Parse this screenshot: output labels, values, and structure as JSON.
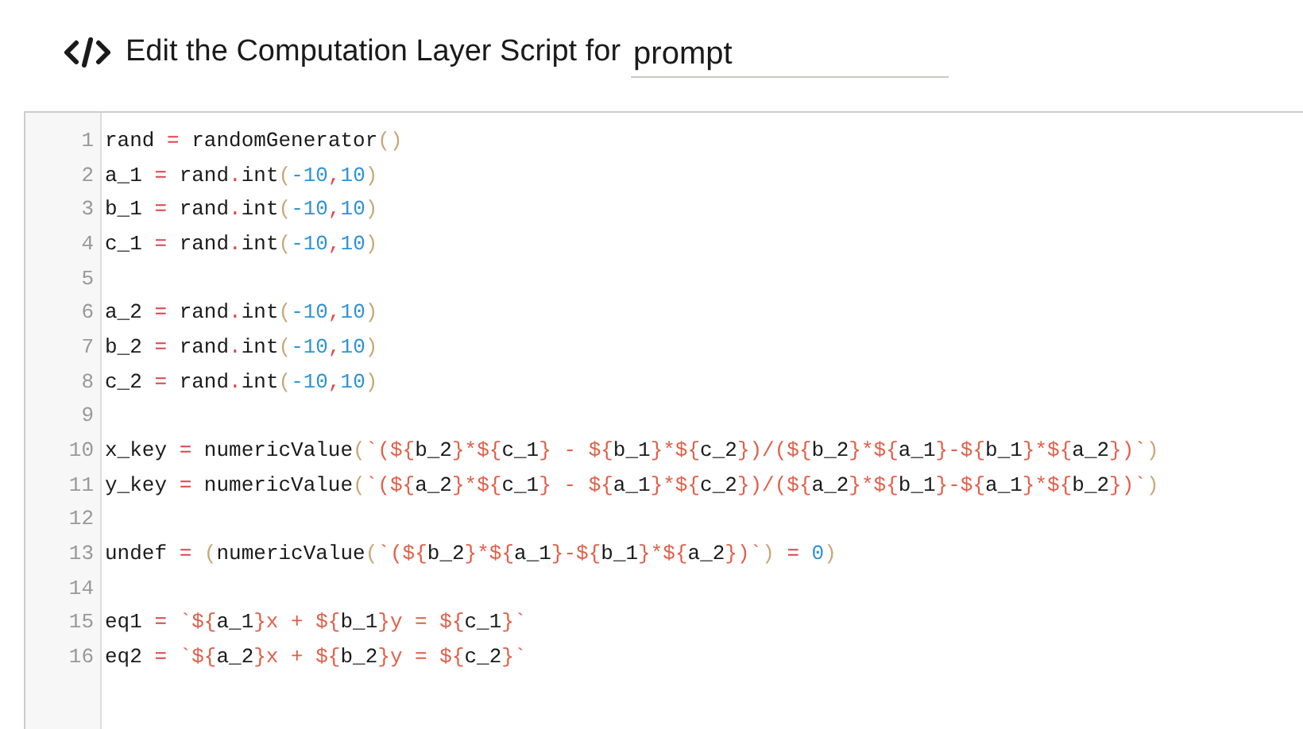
{
  "header": {
    "title": "Edit the Computation Layer Script for",
    "field_value": "prompt"
  },
  "editor": {
    "lines": [
      {
        "number": "1",
        "tokens": [
          {
            "kind": "name",
            "text": "rand"
          },
          {
            "kind": "operator",
            "text": " = "
          },
          {
            "kind": "name",
            "text": "randomGenerator"
          },
          {
            "kind": "bracket",
            "text": "()"
          }
        ]
      },
      {
        "number": "2",
        "tokens": [
          {
            "kind": "name",
            "text": "a_1"
          },
          {
            "kind": "operator",
            "text": " = "
          },
          {
            "kind": "name",
            "text": "rand"
          },
          {
            "kind": "operator",
            "text": "."
          },
          {
            "kind": "name",
            "text": "int"
          },
          {
            "kind": "bracket",
            "text": "("
          },
          {
            "kind": "number",
            "text": "-10"
          },
          {
            "kind": "operator",
            "text": ","
          },
          {
            "kind": "number",
            "text": "10"
          },
          {
            "kind": "bracket",
            "text": ")"
          }
        ]
      },
      {
        "number": "3",
        "tokens": [
          {
            "kind": "name",
            "text": "b_1"
          },
          {
            "kind": "operator",
            "text": " = "
          },
          {
            "kind": "name",
            "text": "rand"
          },
          {
            "kind": "operator",
            "text": "."
          },
          {
            "kind": "name",
            "text": "int"
          },
          {
            "kind": "bracket",
            "text": "("
          },
          {
            "kind": "number",
            "text": "-10"
          },
          {
            "kind": "operator",
            "text": ","
          },
          {
            "kind": "number",
            "text": "10"
          },
          {
            "kind": "bracket",
            "text": ")"
          }
        ]
      },
      {
        "number": "4",
        "tokens": [
          {
            "kind": "name",
            "text": "c_1"
          },
          {
            "kind": "operator",
            "text": " = "
          },
          {
            "kind": "name",
            "text": "rand"
          },
          {
            "kind": "operator",
            "text": "."
          },
          {
            "kind": "name",
            "text": "int"
          },
          {
            "kind": "bracket",
            "text": "("
          },
          {
            "kind": "number",
            "text": "-10"
          },
          {
            "kind": "operator",
            "text": ","
          },
          {
            "kind": "number",
            "text": "10"
          },
          {
            "kind": "bracket",
            "text": ")"
          }
        ]
      },
      {
        "number": "5"
      },
      {
        "number": "6",
        "tokens": [
          {
            "kind": "name",
            "text": "a_2"
          },
          {
            "kind": "operator",
            "text": " = "
          },
          {
            "kind": "name",
            "text": "rand"
          },
          {
            "kind": "operator",
            "text": "."
          },
          {
            "kind": "name",
            "text": "int"
          },
          {
            "kind": "bracket",
            "text": "("
          },
          {
            "kind": "number",
            "text": "-10"
          },
          {
            "kind": "operator",
            "text": ","
          },
          {
            "kind": "number",
            "text": "10"
          },
          {
            "kind": "bracket",
            "text": ")"
          }
        ]
      },
      {
        "number": "7",
        "tokens": [
          {
            "kind": "name",
            "text": "b_2"
          },
          {
            "kind": "operator",
            "text": " = "
          },
          {
            "kind": "name",
            "text": "rand"
          },
          {
            "kind": "operator",
            "text": "."
          },
          {
            "kind": "name",
            "text": "int"
          },
          {
            "kind": "bracket",
            "text": "("
          },
          {
            "kind": "number",
            "text": "-10"
          },
          {
            "kind": "operator",
            "text": ","
          },
          {
            "kind": "number",
            "text": "10"
          },
          {
            "kind": "bracket",
            "text": ")"
          }
        ]
      },
      {
        "number": "8",
        "tokens": [
          {
            "kind": "name",
            "text": "c_2"
          },
          {
            "kind": "operator",
            "text": " = "
          },
          {
            "kind": "name",
            "text": "rand"
          },
          {
            "kind": "operator",
            "text": "."
          },
          {
            "kind": "name",
            "text": "int"
          },
          {
            "kind": "bracket",
            "text": "("
          },
          {
            "kind": "number",
            "text": "-10"
          },
          {
            "kind": "operator",
            "text": ","
          },
          {
            "kind": "number",
            "text": "10"
          },
          {
            "kind": "bracket",
            "text": ")"
          }
        ]
      },
      {
        "number": "9"
      },
      {
        "number": "10",
        "tokens": [
          {
            "kind": "name",
            "text": "x_key"
          },
          {
            "kind": "operator",
            "text": " = "
          },
          {
            "kind": "name",
            "text": "numericValue"
          },
          {
            "kind": "bracket",
            "text": "("
          },
          {
            "kind": "string",
            "text": "`(${"
          },
          {
            "kind": "name",
            "text": "b_2"
          },
          {
            "kind": "string",
            "text": "}*${"
          },
          {
            "kind": "name",
            "text": "c_1"
          },
          {
            "kind": "string",
            "text": "} - ${"
          },
          {
            "kind": "name",
            "text": "b_1"
          },
          {
            "kind": "string",
            "text": "}*${"
          },
          {
            "kind": "name",
            "text": "c_2"
          },
          {
            "kind": "string",
            "text": "})/(${"
          },
          {
            "kind": "name",
            "text": "b_2"
          },
          {
            "kind": "string",
            "text": "}*${"
          },
          {
            "kind": "name",
            "text": "a_1"
          },
          {
            "kind": "string",
            "text": "}-${"
          },
          {
            "kind": "name",
            "text": "b_1"
          },
          {
            "kind": "string",
            "text": "}*${"
          },
          {
            "kind": "name",
            "text": "a_2"
          },
          {
            "kind": "string",
            "text": "})`"
          },
          {
            "kind": "bracket",
            "text": ")"
          }
        ]
      },
      {
        "number": "11",
        "tokens": [
          {
            "kind": "name",
            "text": "y_key"
          },
          {
            "kind": "operator",
            "text": " = "
          },
          {
            "kind": "name",
            "text": "numericValue"
          },
          {
            "kind": "bracket",
            "text": "("
          },
          {
            "kind": "string",
            "text": "`(${"
          },
          {
            "kind": "name",
            "text": "a_2"
          },
          {
            "kind": "string",
            "text": "}*${"
          },
          {
            "kind": "name",
            "text": "c_1"
          },
          {
            "kind": "string",
            "text": "} - ${"
          },
          {
            "kind": "name",
            "text": "a_1"
          },
          {
            "kind": "string",
            "text": "}*${"
          },
          {
            "kind": "name",
            "text": "c_2"
          },
          {
            "kind": "string",
            "text": "})/(${"
          },
          {
            "kind": "name",
            "text": "a_2"
          },
          {
            "kind": "string",
            "text": "}*${"
          },
          {
            "kind": "name",
            "text": "b_1"
          },
          {
            "kind": "string",
            "text": "}-${"
          },
          {
            "kind": "name",
            "text": "a_1"
          },
          {
            "kind": "string",
            "text": "}*${"
          },
          {
            "kind": "name",
            "text": "b_2"
          },
          {
            "kind": "string",
            "text": "})`"
          },
          {
            "kind": "bracket",
            "text": ")"
          }
        ]
      },
      {
        "number": "12"
      },
      {
        "number": "13",
        "tokens": [
          {
            "kind": "name",
            "text": "undef"
          },
          {
            "kind": "operator",
            "text": " = "
          },
          {
            "kind": "bracket",
            "text": "("
          },
          {
            "kind": "name",
            "text": "numericValue"
          },
          {
            "kind": "bracket",
            "text": "("
          },
          {
            "kind": "string",
            "text": "`(${"
          },
          {
            "kind": "name",
            "text": "b_2"
          },
          {
            "kind": "string",
            "text": "}*${"
          },
          {
            "kind": "name",
            "text": "a_1"
          },
          {
            "kind": "string",
            "text": "}-${"
          },
          {
            "kind": "name",
            "text": "b_1"
          },
          {
            "kind": "string",
            "text": "}*${"
          },
          {
            "kind": "name",
            "text": "a_2"
          },
          {
            "kind": "string",
            "text": "})`"
          },
          {
            "kind": "bracket",
            "text": ")"
          },
          {
            "kind": "operator",
            "text": " = "
          },
          {
            "kind": "number",
            "text": "0"
          },
          {
            "kind": "bracket",
            "text": ")"
          }
        ]
      },
      {
        "number": "14"
      },
      {
        "number": "15",
        "tokens": [
          {
            "kind": "name",
            "text": "eq1"
          },
          {
            "kind": "operator",
            "text": " = "
          },
          {
            "kind": "string",
            "text": "`${"
          },
          {
            "kind": "name",
            "text": "a_1"
          },
          {
            "kind": "string",
            "text": "}x + ${"
          },
          {
            "kind": "name",
            "text": "b_1"
          },
          {
            "kind": "string",
            "text": "}y = ${"
          },
          {
            "kind": "name",
            "text": "c_1"
          },
          {
            "kind": "string",
            "text": "}`"
          }
        ]
      },
      {
        "number": "16",
        "tokens": [
          {
            "kind": "name",
            "text": "eq2"
          },
          {
            "kind": "operator",
            "text": " = "
          },
          {
            "kind": "string",
            "text": "`${"
          },
          {
            "kind": "name",
            "text": "a_2"
          },
          {
            "kind": "string",
            "text": "}x + ${"
          },
          {
            "kind": "name",
            "text": "b_2"
          },
          {
            "kind": "string",
            "text": "}y = ${"
          },
          {
            "kind": "name",
            "text": "c_2"
          },
          {
            "kind": "string",
            "text": "}`"
          }
        ]
      }
    ]
  }
}
